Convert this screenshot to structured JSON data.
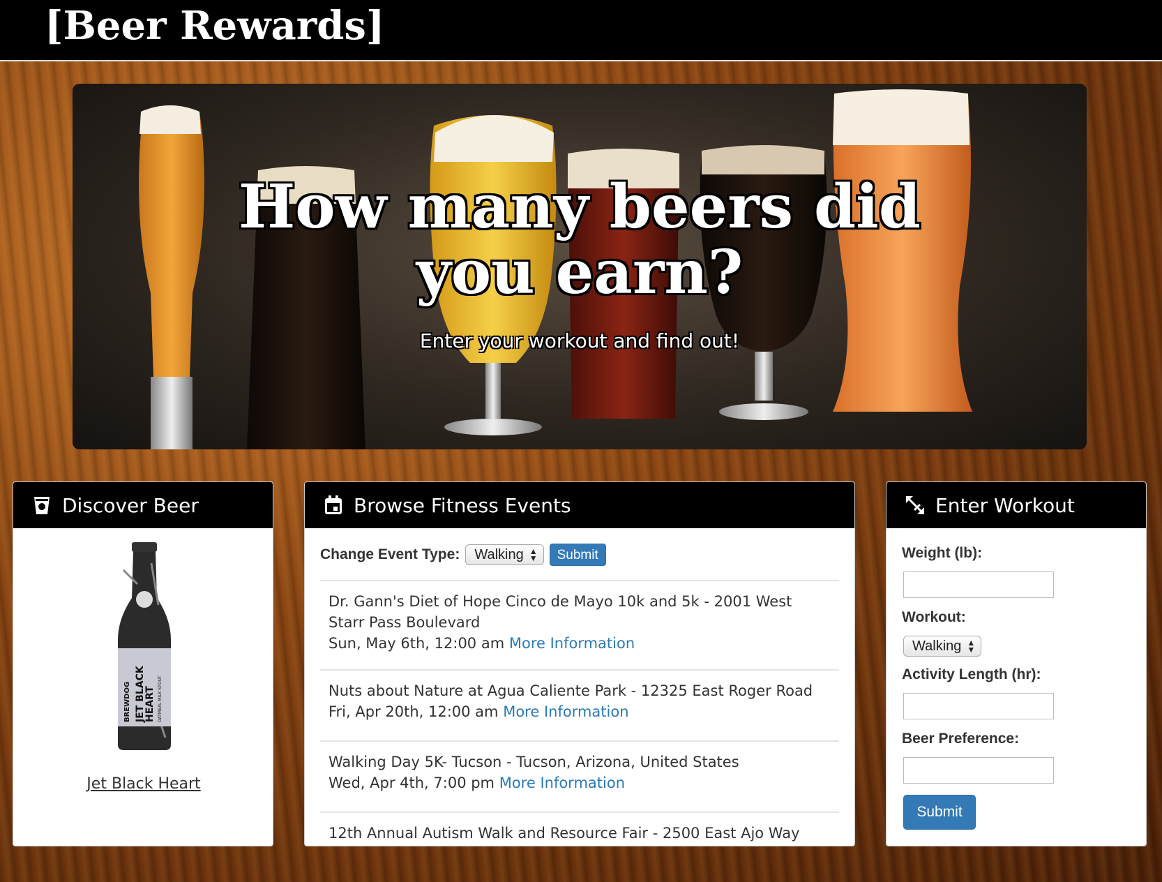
{
  "header": {
    "brand": "[Beer Rewards]"
  },
  "hero": {
    "title": "How many beers did you earn?",
    "subtitle": "Enter your workout and find out!"
  },
  "discover": {
    "heading": "Discover Beer",
    "icon": "beer-glass-icon",
    "beer_name": "Jet Black Heart",
    "bottle_label": [
      "BREWDOG",
      "JET BLACK",
      "HEART",
      "OATMEAL MILK STOUT"
    ]
  },
  "events": {
    "heading": "Browse Fitness Events",
    "icon": "calendar-icon",
    "change_label": "Change Event Type:",
    "selected_type": "Walking",
    "submit_label": "Submit",
    "items": [
      {
        "title": "Dr. Gann's Diet of Hope Cinco de Mayo 10k and 5k - 2001 West Starr Pass Boulevard",
        "date": "Sun, May 6th, 12:00 am",
        "link": "More Information"
      },
      {
        "title": "Nuts about Nature at Agua Caliente Park - 12325 East Roger Road",
        "date": "Fri, Apr 20th, 12:00 am",
        "link": "More Information"
      },
      {
        "title": "Walking Day 5K- Tucson - Tucson, Arizona, United States",
        "date": "Wed, Apr 4th, 7:00 pm",
        "link": "More Information"
      },
      {
        "title": "12th Annual Autism Walk and Resource Fair - 2500 East Ajo Way",
        "date": "",
        "link": ""
      }
    ]
  },
  "workout": {
    "heading": "Enter Workout",
    "icon": "resize-arrows-icon",
    "weight_label": "Weight (lb):",
    "weight_value": "",
    "workout_label": "Workout:",
    "workout_selected": "Walking",
    "length_label": "Activity Length (hr):",
    "length_value": "",
    "preference_label": "Beer Preference:",
    "preference_value": "",
    "submit_label": "Submit"
  }
}
